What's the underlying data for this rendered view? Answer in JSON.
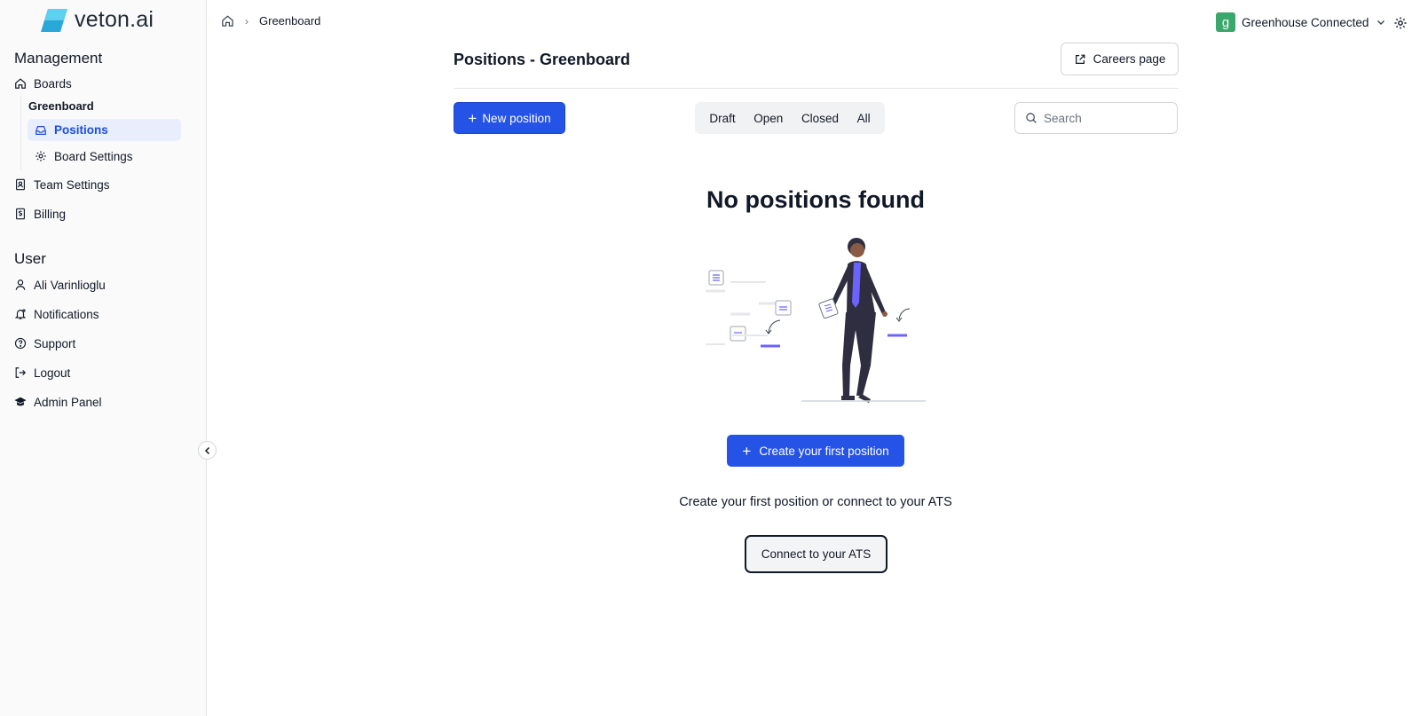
{
  "brand": {
    "name": "veton.ai"
  },
  "sidebar": {
    "management_title": "Management",
    "boards_label": "Boards",
    "board_name": "Greenboard",
    "positions_label": "Positions",
    "board_settings_label": "Board Settings",
    "team_settings_label": "Team Settings",
    "billing_label": "Billing",
    "user_title": "User",
    "user_name": "Ali Varinlioglu",
    "notifications_label": "Notifications",
    "support_label": "Support",
    "logout_label": "Logout",
    "admin_panel_label": "Admin Panel"
  },
  "breadcrumb": {
    "current": "Greenboard"
  },
  "integration": {
    "label": "Greenhouse Connected",
    "logo_letter": "g",
    "color": "#3aa76d"
  },
  "main": {
    "title": "Positions - Greenboard",
    "careers_button": "Careers page",
    "new_position_button": "New position",
    "tabs": [
      "Draft",
      "Open",
      "Closed",
      "All"
    ],
    "search_placeholder": "Search",
    "empty_title": "No positions found",
    "create_first_button": "Create your first position",
    "helper_text": "Create your first position or connect to your ATS",
    "connect_ats_button": "Connect to your ATS"
  },
  "colors": {
    "accent": "#2553e6",
    "active_bg": "#e8eefc",
    "illustration_accent": "#6c63ff"
  }
}
